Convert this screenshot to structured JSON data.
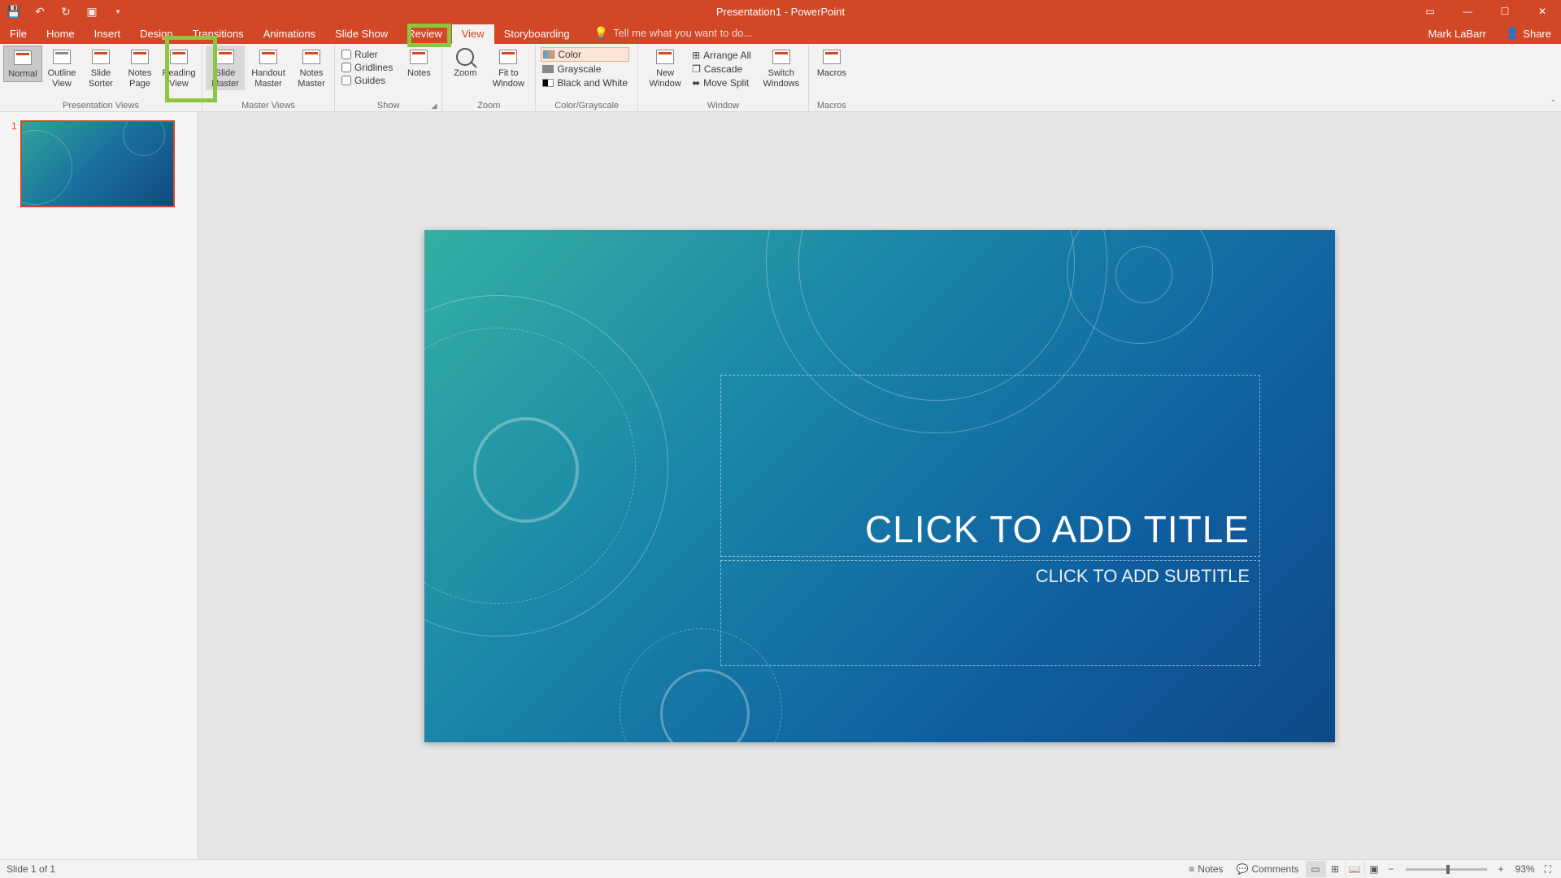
{
  "titlebar": {
    "title": "Presentation1 - PowerPoint"
  },
  "tabs": {
    "file": "File",
    "items": [
      "Home",
      "Insert",
      "Design",
      "Transitions",
      "Animations",
      "Slide Show",
      "Review",
      "View",
      "Storyboarding"
    ],
    "active": "View",
    "tell_me_placeholder": "Tell me what you want to do...",
    "account": "Mark LaBarr",
    "share": "Share"
  },
  "ribbon": {
    "presentation_views": {
      "label": "Presentation Views",
      "normal": "Normal",
      "outline_view": "Outline View",
      "slide_sorter": "Slide Sorter",
      "notes_page": "Notes Page",
      "reading_view": "Reading View"
    },
    "master_views": {
      "label": "Master Views",
      "slide_master": "Slide Master",
      "handout_master": "Handout Master",
      "notes_master": "Notes Master"
    },
    "show": {
      "label": "Show",
      "ruler": "Ruler",
      "gridlines": "Gridlines",
      "guides": "Guides",
      "notes": "Notes"
    },
    "zoom": {
      "label": "Zoom",
      "zoom": "Zoom",
      "fit": "Fit to Window"
    },
    "color_grayscale": {
      "label": "Color/Grayscale",
      "color": "Color",
      "grayscale": "Grayscale",
      "bw": "Black and White"
    },
    "window": {
      "label": "Window",
      "new_window": "New Window",
      "arrange_all": "Arrange All",
      "cascade": "Cascade",
      "move_split": "Move Split",
      "switch": "Switch Windows"
    },
    "macros": {
      "label": "Macros",
      "macros": "Macros"
    }
  },
  "thumbs": {
    "num1": "1"
  },
  "slide": {
    "title_placeholder": "CLICK TO ADD TITLE",
    "subtitle_placeholder": "CLICK TO ADD SUBTITLE"
  },
  "statusbar": {
    "slide_info": "Slide 1 of 1",
    "notes": "Notes",
    "comments": "Comments",
    "zoom": "93%"
  }
}
